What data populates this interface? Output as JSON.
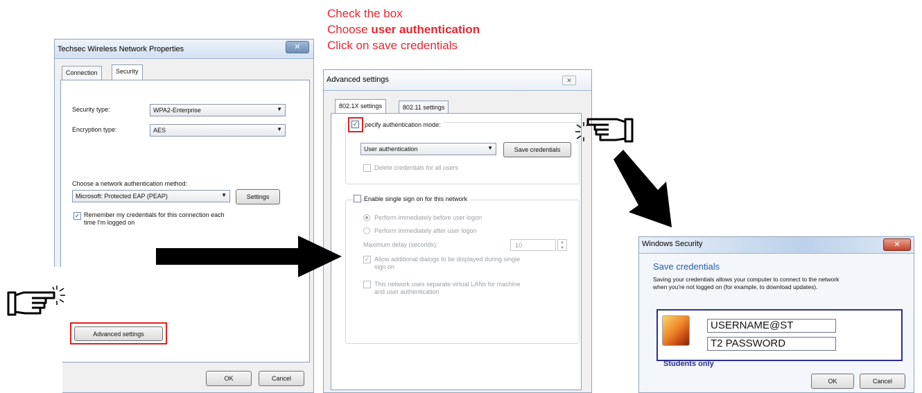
{
  "instructions": {
    "line1": "Check the box",
    "line2_prefix": "Choose ",
    "line2_strong": "user authentication",
    "line3": "Click on save credentials"
  },
  "network_properties": {
    "title": "Techsec Wireless Network Properties",
    "tabs": [
      "Connection",
      "Security"
    ],
    "security_type_label": "Security type:",
    "security_type_value": "WPA2-Enterprise",
    "encryption_type_label": "Encryption type:",
    "encryption_type_value": "AES",
    "auth_method_label": "Choose a network authentication method:",
    "auth_method_value": "Microsoft: Protected EAP (PEAP)",
    "settings_button": "Settings",
    "remember_label_line1": "Remember my credentials for this connection each",
    "remember_label_line2": "time I'm logged on",
    "advanced_button": "Advanced settings",
    "ok_button": "OK",
    "cancel_button": "Cancel"
  },
  "advanced_settings": {
    "title": "Advanced settings",
    "close_glyph": "✕",
    "tabs": [
      "802.1X settings",
      "802.11 settings"
    ],
    "specify_label": "pecify authentication mode:",
    "auth_mode_value": "User authentication",
    "save_credentials_button": "Save credentials",
    "delete_label": "Delete credentials for all users",
    "sso_label": "Enable single sign on for this network",
    "before_logon_label": "Perform immediately before user logon",
    "after_logon_label": "Perform immediately after user logon",
    "max_delay_label": "Maximum delay (seconds):",
    "max_delay_value": "10",
    "allow_dialogs_line1": "Allow additional dialogs to be displayed during single",
    "allow_dialogs_line2": "sign on",
    "vlan_line1": "This network uses separate virtual LANs for machine",
    "vlan_line2": "and user authentication"
  },
  "windows_security": {
    "title": "Windows Security",
    "heading": "Save credentials",
    "description_line1": "Saving your credentials allows your computer to connect to the network",
    "description_line2": "when you're not logged on (for example, to download updates).",
    "username_value": "USERNAME@ST",
    "password_value": "T2 PASSWORD",
    "students_only": "Students only",
    "ok_button": "OK",
    "cancel_button": "Cancel"
  },
  "colors": {
    "instruction_red": "#e8262f",
    "highlight_red": "#e02020",
    "heading_blue": "#1f5fa8",
    "frame_navy": "#2b2f8f"
  }
}
